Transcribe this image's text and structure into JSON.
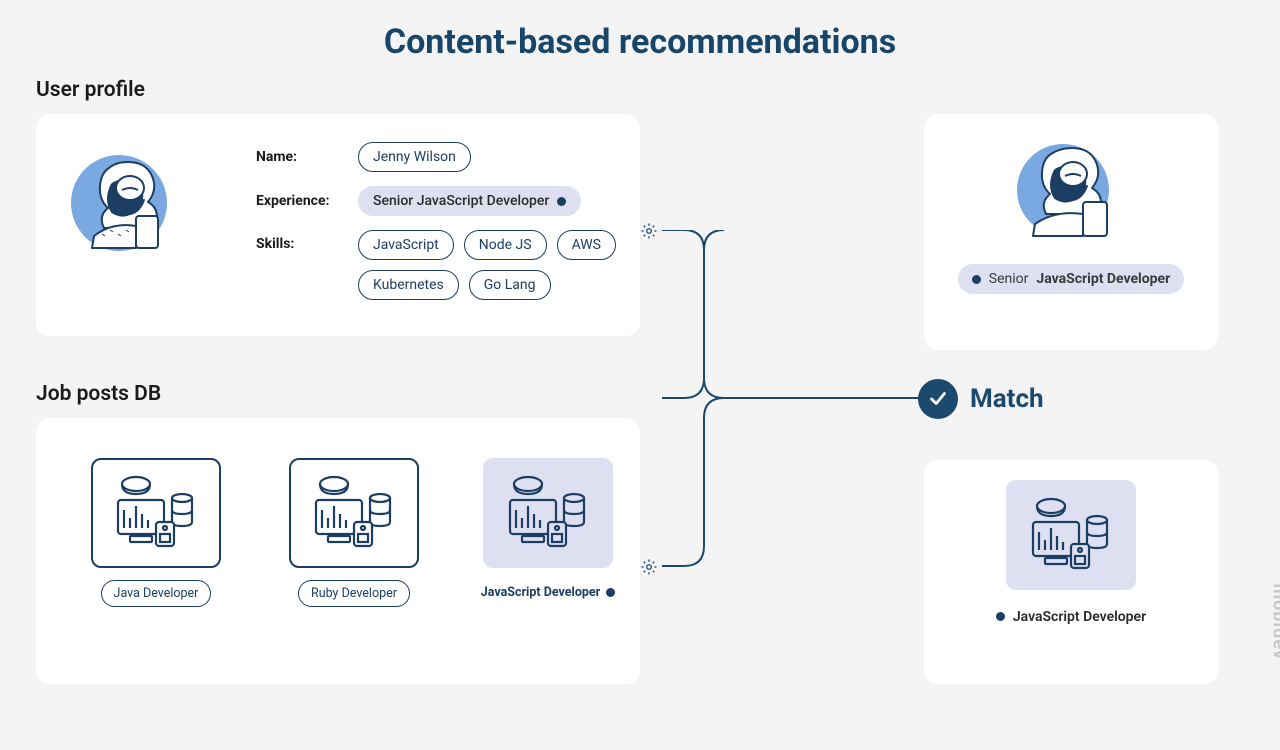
{
  "title": "Content-based recommendations",
  "sections": {
    "user_profile": "User profile",
    "job_posts": "Job posts DB"
  },
  "profile": {
    "name_label": "Name:",
    "name_value": "Jenny Wilson",
    "experience_label": "Experience:",
    "experience_value": "Senior JavaScript Developer",
    "skills_label": "Skills:",
    "skills": [
      "JavaScript",
      "Node JS",
      "AWS",
      "Kubernetes",
      "Go Lang"
    ]
  },
  "jobs": [
    {
      "label": "Java Developer",
      "match": false
    },
    {
      "label": "Ruby Developer",
      "match": false
    },
    {
      "label": "JavaScript Developer",
      "match": true
    }
  ],
  "match_label": "Match",
  "result": {
    "title_prefix": "Senior",
    "title_bold": "JavaScript Developer",
    "job": "JavaScript Developer"
  },
  "brand": "mobidev",
  "colors": {
    "accent": "#1c4a6e",
    "highlight": "#dee0f2"
  }
}
